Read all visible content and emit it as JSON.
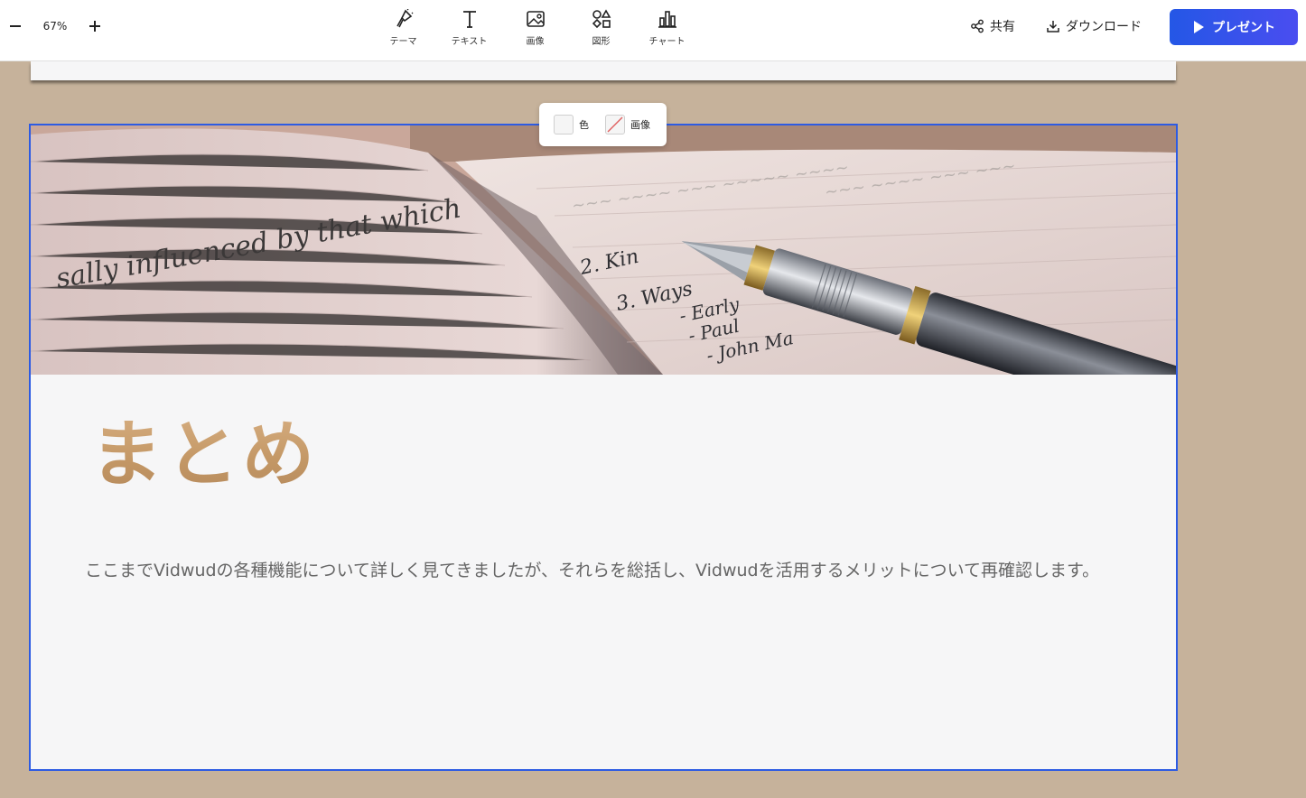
{
  "toolbar": {
    "zoom_level": "67%",
    "tools": [
      {
        "label": "テーマ",
        "icon": "theme-icon"
      },
      {
        "label": "テキスト",
        "icon": "text-icon"
      },
      {
        "label": "画像",
        "icon": "image-icon"
      },
      {
        "label": "図形",
        "icon": "shapes-icon"
      },
      {
        "label": "チャート",
        "icon": "chart-icon"
      }
    ],
    "share_label": "共有",
    "download_label": "ダウンロード",
    "present_label": "プレゼント"
  },
  "background_popover": {
    "color_label": "色",
    "image_label": "画像"
  },
  "slide": {
    "title": "まとめ",
    "body": "ここまでVidwudの各種機能について詳しく見てきましたが、それらを総括し、Vidwudを活用するメリットについて再確認します。"
  },
  "hero_image": {
    "handwriting_left": "sally influenced by that which",
    "handwriting_list": [
      "2. Kin",
      "3. Ways",
      "- Early",
      "- Paul",
      "- John Ma"
    ]
  },
  "colors": {
    "accent": "#2d5be3",
    "present_button": "#3652ea",
    "title_gold": "#c49866",
    "canvas_bg": "#c6b29b"
  }
}
